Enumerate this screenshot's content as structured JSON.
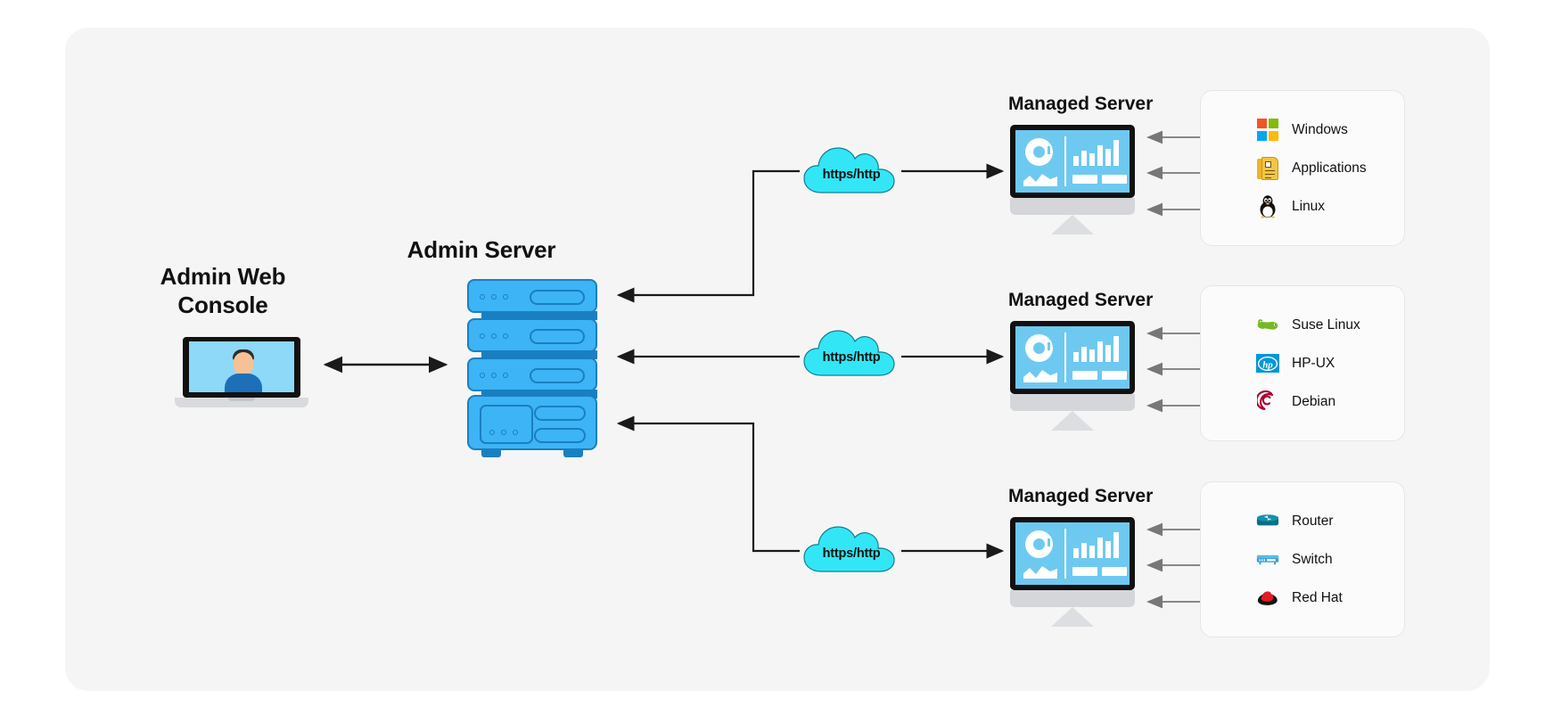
{
  "diagram": {
    "title_admin_console": "Admin Web\nConsole",
    "admin_console_label_line1": "Admin Web",
    "admin_console_label_line2": "Console",
    "admin_server_label": "Admin Server",
    "protocol_label": "https/http",
    "managed_server_label": "Managed Server",
    "background_panel_color": "#f5f5f5",
    "page_background": "#ffffff",
    "accent_blue": "#3cb4f5",
    "accent_blue_dark": "#1a7fc1",
    "cloud_color": "#33e6f5",
    "screen_blue": "#6ec9f0",
    "connector_color": "#1a1a1a",
    "arrow_gray": "#6b6b6b"
  },
  "clouds": [
    {
      "label": "https/http"
    },
    {
      "label": "https/http"
    },
    {
      "label": "https/http"
    }
  ],
  "managed_servers": [
    {
      "title": "Managed Server"
    },
    {
      "title": "Managed Server"
    },
    {
      "title": "Managed Server"
    }
  ],
  "cards": [
    {
      "rows": [
        {
          "label": "Windows",
          "icon": "windows-icon"
        },
        {
          "label": "Applications",
          "icon": "applications-icon"
        },
        {
          "label": "Linux",
          "icon": "linux-tux-icon"
        }
      ]
    },
    {
      "rows": [
        {
          "label": "Suse Linux",
          "icon": "suse-chameleon-icon"
        },
        {
          "label": "HP-UX",
          "icon": "hp-icon"
        },
        {
          "label": "Debian",
          "icon": "debian-swirl-icon"
        }
      ]
    },
    {
      "rows": [
        {
          "label": "Router",
          "icon": "router-icon"
        },
        {
          "label": "Switch",
          "icon": "switch-icon"
        },
        {
          "label": "Red Hat",
          "icon": "redhat-fedora-icon"
        }
      ]
    }
  ]
}
